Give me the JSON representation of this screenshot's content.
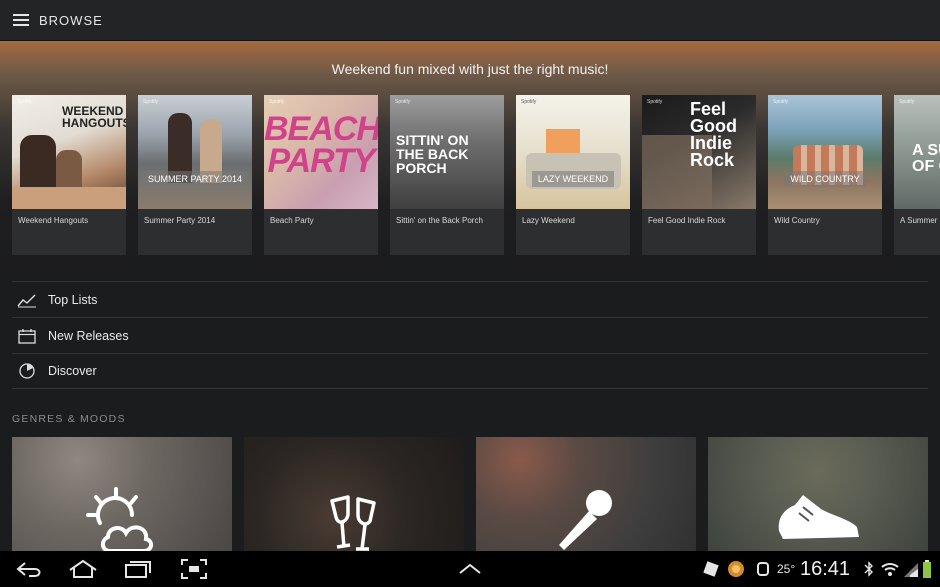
{
  "header": {
    "title": "BROWSE",
    "menu_icon": "hamburger-menu-icon"
  },
  "hero": {
    "headline": "Weekend fun mixed with just the right music!",
    "brand": "Spotify",
    "playlists": [
      {
        "caption": "Weekend Hangouts",
        "art_text": "WEEKEND HANGOUTS",
        "overlay": ""
      },
      {
        "caption": "Summer Party 2014",
        "art_text": "",
        "overlay": "SUMMER PARTY 2014"
      },
      {
        "caption": "Beach Party",
        "art_text": "BEACH PARTY",
        "overlay": ""
      },
      {
        "caption": "Sittin' on the Back Porch",
        "art_text": "SITTIN' ON THE BACK PORCH",
        "overlay": ""
      },
      {
        "caption": "Lazy Weekend",
        "art_text": "",
        "overlay": "LAZY WEEKEND"
      },
      {
        "caption": "Feel Good Indie Rock",
        "art_text": "Feel Good Indie Rock",
        "overlay": ""
      },
      {
        "caption": "Wild Country",
        "art_text": "",
        "overlay": "WILD COUNTRY"
      },
      {
        "caption": "A Summer",
        "art_text": "A SU OF C",
        "overlay": ""
      }
    ]
  },
  "nav": {
    "items": [
      {
        "label": "Top Lists",
        "icon": "line-chart-icon"
      },
      {
        "label": "New Releases",
        "icon": "calendar-icon"
      },
      {
        "label": "Discover",
        "icon": "compass-icon"
      }
    ]
  },
  "genres": {
    "title": "GENRES & MOODS",
    "tiles": [
      {
        "icon": "sun-cloud-icon"
      },
      {
        "icon": "champagne-glasses-icon"
      },
      {
        "icon": "microphone-icon"
      },
      {
        "icon": "running-shoe-icon"
      }
    ]
  },
  "system_bar": {
    "time": "16:41",
    "temperature": "25°",
    "buttons": [
      "back-icon",
      "home-icon",
      "recent-apps-icon",
      "screenshot-icon",
      "expand-up-icon"
    ]
  }
}
